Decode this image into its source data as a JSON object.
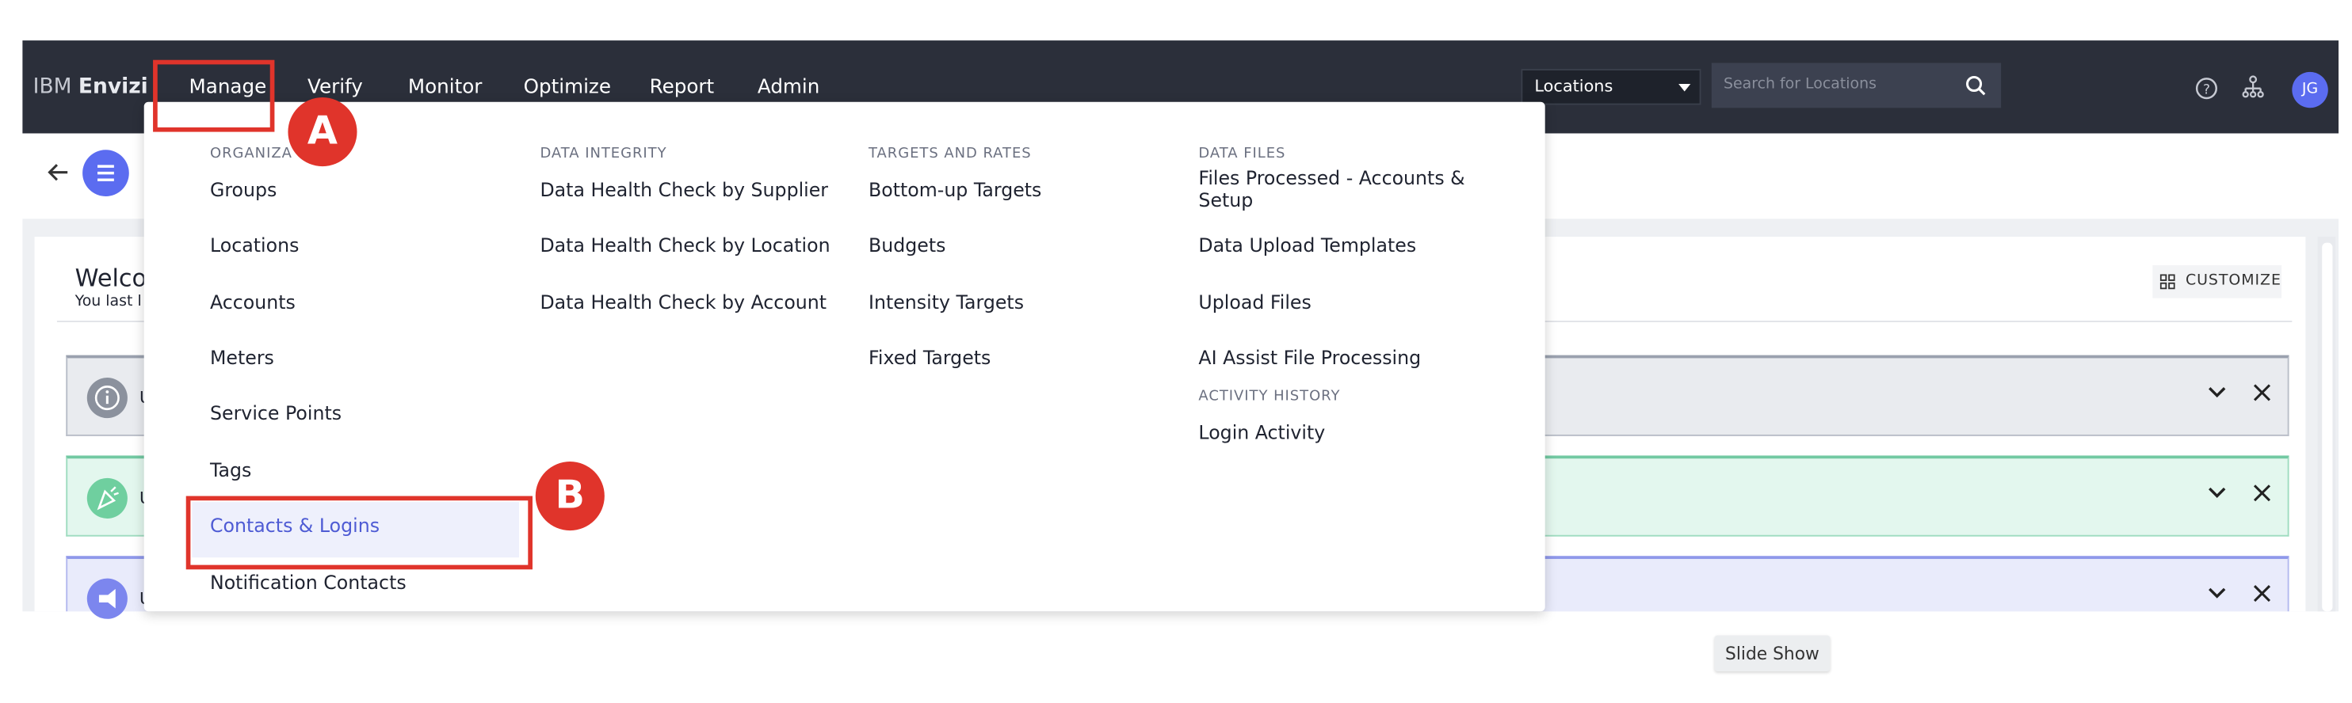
{
  "brand": {
    "prefix": "IBM",
    "name": "Envizi"
  },
  "nav": [
    "Manage",
    "Verify",
    "Monitor",
    "Optimize",
    "Report",
    "Admin"
  ],
  "search": {
    "scope": "Locations",
    "placeholder": "Search for Locations"
  },
  "user": {
    "initials": "JG"
  },
  "page": {
    "welcome": "Welco",
    "last_login": "You last l",
    "customize": "CUSTOMIZE",
    "banner_initial": "U"
  },
  "menu": {
    "col1": {
      "header": "ORGANIZA",
      "items": [
        "Groups",
        "Locations",
        "Accounts",
        "Meters",
        "Service Points",
        "Tags",
        "Contacts & Logins",
        "Notification Contacts"
      ]
    },
    "col2": {
      "header": "DATA INTEGRITY",
      "items": [
        "Data Health Check by Supplier",
        "Data Health Check by Location",
        "Data Health Check by Account"
      ]
    },
    "col3": {
      "header": "TARGETS AND RATES",
      "items": [
        "Bottom-up Targets",
        "Budgets",
        "Intensity Targets",
        "Fixed Targets"
      ]
    },
    "col4": {
      "header": "DATA FILES",
      "items": [
        "Files Processed - Accounts & Setup",
        "Data Upload Templates",
        "Upload Files",
        "AI Assist File Processing"
      ],
      "header2": "ACTIVITY HISTORY",
      "items2": [
        "Login Activity"
      ]
    }
  },
  "callouts": {
    "a": "A",
    "b": "B"
  },
  "slideshow": "Slide Show",
  "colors": {
    "accent": "#5b6cf0",
    "callout": "#e0342b",
    "topbar": "#2b2f3a"
  }
}
